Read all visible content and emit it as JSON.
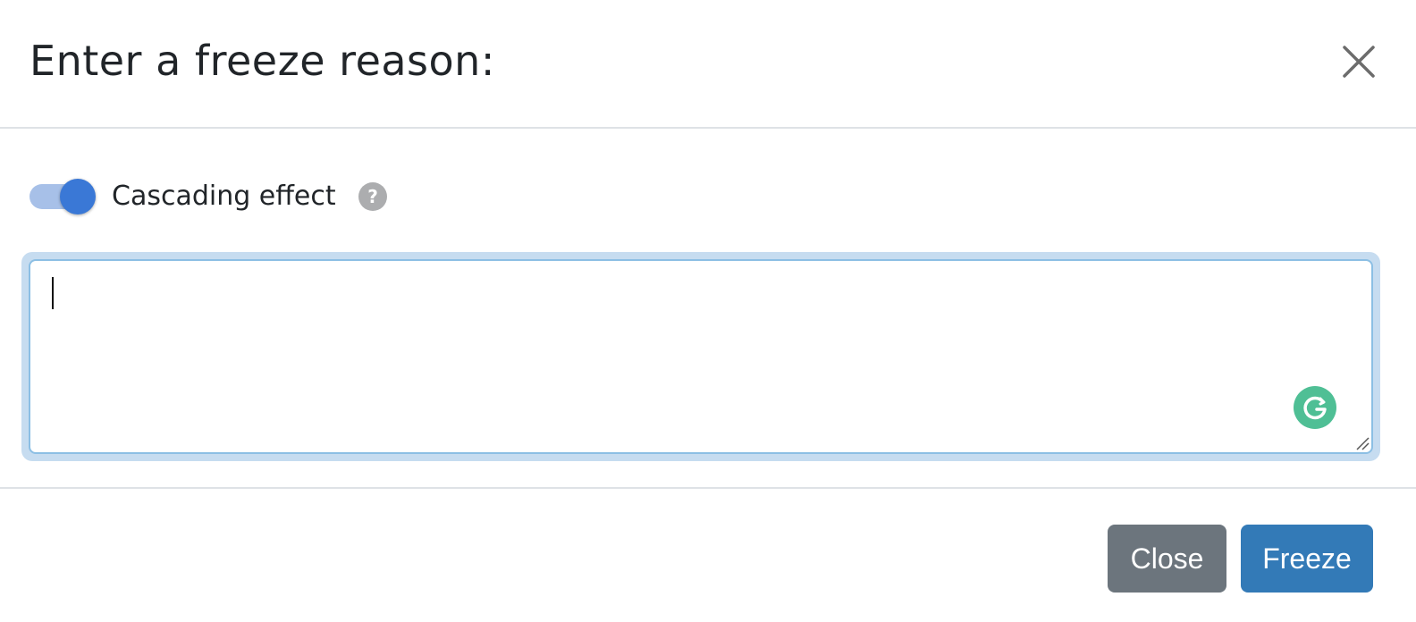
{
  "dialog": {
    "title": "Enter a freeze reason:"
  },
  "cascading_toggle": {
    "label": "Cascading effect",
    "checked": true,
    "help_glyph": "?",
    "track_color": "#a7c0e8",
    "thumb_color": "#3a78d6"
  },
  "reason_field": {
    "value": "",
    "focused": true,
    "grammarly_icon": "grammarly-icon"
  },
  "footer": {
    "close_label": "Close",
    "freeze_label": "Freeze",
    "close_color": "#6c757d",
    "freeze_color": "#337ab7"
  },
  "icons": {
    "dismiss": "close-icon",
    "help": "help-icon",
    "resize": "resize-handle-icon"
  }
}
